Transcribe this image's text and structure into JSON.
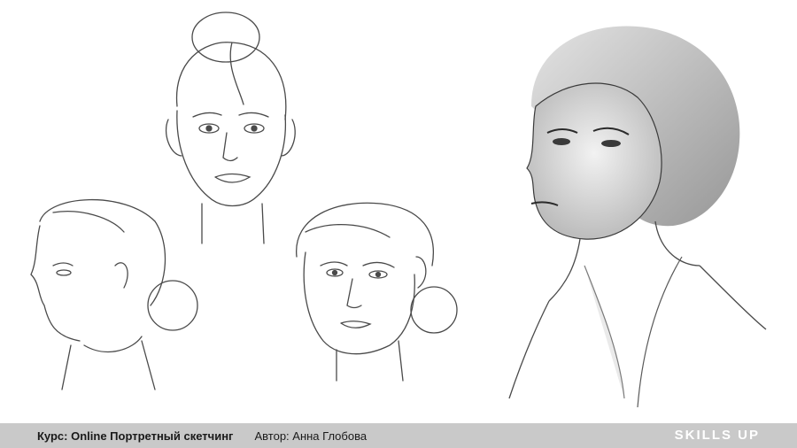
{
  "footer": {
    "course_label": "Курс: Online Портретный скетчинг",
    "author_label": "Автор: Анна Глобова",
    "brand": "SKILLS UP"
  },
  "colors": {
    "footer_bg": "#c9c9c9",
    "brand": "#ffffff",
    "sketch_line": "#4a4a4a"
  }
}
